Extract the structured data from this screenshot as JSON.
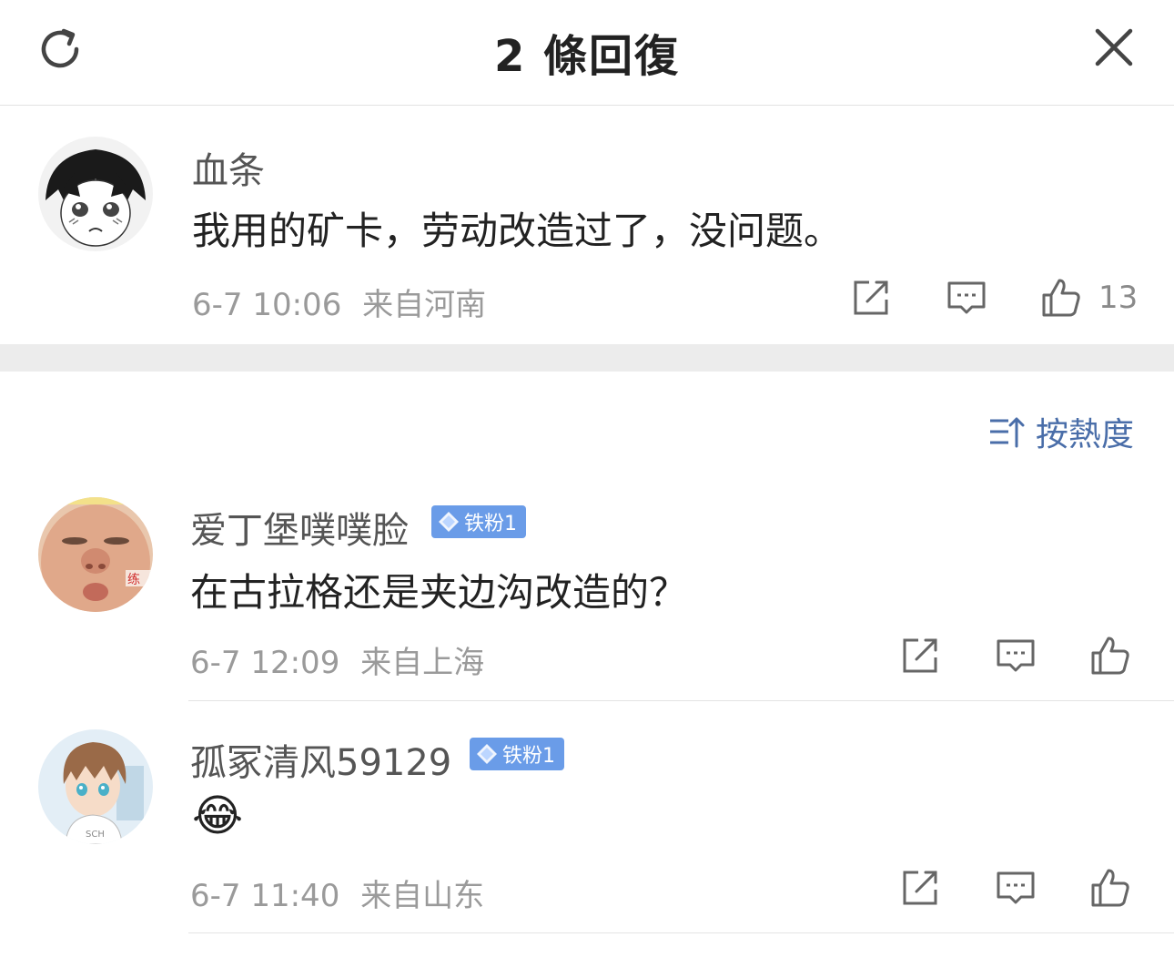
{
  "header": {
    "title": "2 條回復",
    "refresh_icon": "refresh-icon",
    "close_icon": "close-icon"
  },
  "root_comment": {
    "username": "血条",
    "text": "我用的矿卡，劳动改造过了，没问题。",
    "time": "6-7 10:06",
    "location": "来自河南",
    "like_count": "13"
  },
  "sort": {
    "label": "按熱度",
    "icon": "sort-icon"
  },
  "replies": [
    {
      "username": "爱丁堡噗噗脸",
      "badge": "铁粉1",
      "text": "在古拉格还是夹边沟改造的？",
      "time": "6-7 12:09",
      "location": "来自上海"
    },
    {
      "username": "孤冢清风59129",
      "badge": "铁粉1",
      "text": "😂",
      "time": "6-7 11:40",
      "location": "来自山东"
    }
  ],
  "colors": {
    "accent": "#4a6ea9",
    "badge": "#6a9ce8",
    "separator": "#ececec"
  }
}
